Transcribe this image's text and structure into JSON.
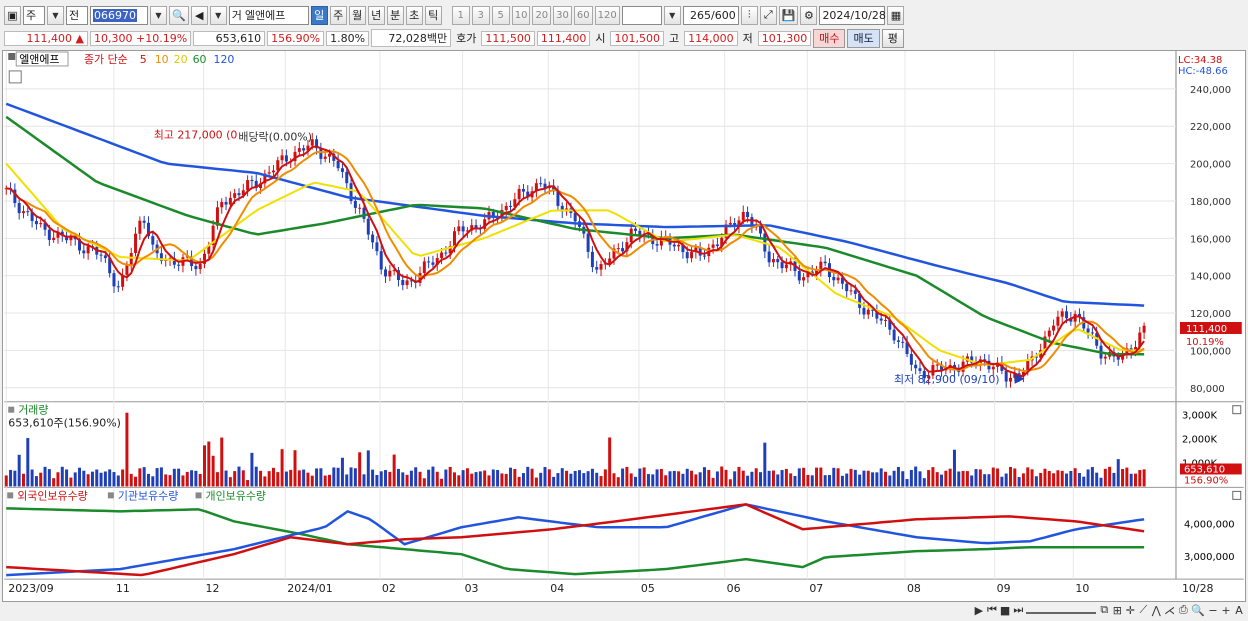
{
  "toolbar": {
    "period_type": "주",
    "prev_label": "전",
    "code": "066970",
    "stock_name_prefix": "거",
    "stock_name": "엘앤에프",
    "period_tabs": [
      "일",
      "주",
      "월",
      "년",
      "분",
      "초",
      "틱"
    ],
    "active_period": "일",
    "intervals": [
      "1",
      "3",
      "5",
      "10",
      "20",
      "30",
      "60",
      "120"
    ],
    "count": "265",
    "count_total": "/600",
    "date": "2024/10/28"
  },
  "quote": {
    "price": "111,400",
    "change": "10,300",
    "change_pct": "+10.19%",
    "volume": "653,610",
    "volume_ratio": "156.90%",
    "turnover_pct": "1.80%",
    "trade_value": "72,028백만",
    "ask_label": "호가",
    "ask1": "111,500",
    "ask2": "111,400",
    "open_label": "시",
    "open": "101,500",
    "high_label": "고",
    "high": "114,000",
    "low_label": "저",
    "low": "101,300",
    "buy_label": "매수",
    "sell_label": "매도",
    "eval_label": "평"
  },
  "price_panel": {
    "stock_tab": "엘앤에프",
    "legend_prefix": "종가 단순",
    "ma_periods": [
      "5",
      "10",
      "20",
      "60",
      "120"
    ],
    "ma_colors": [
      "#d01010",
      "#f08c00",
      "#f0e000",
      "#1a8a2a",
      "#2255dd"
    ],
    "lc": "LC:34.38",
    "hc": "HC:-48.66",
    "high_note": "최고 217,000 (0",
    "high_note2": "배당락(0.00%)",
    "low_note": "최저 82,900 (09/10)",
    "price_tag": "111,400",
    "pct_tag": "10.19%",
    "y_ticks": [
      "240,000",
      "220,000",
      "200,000",
      "180,000",
      "160,000",
      "140,000",
      "120,000",
      "100,000",
      "80,000"
    ]
  },
  "volume_panel": {
    "title": "거래량",
    "value": "653,610주(156.90%)",
    "y_ticks": [
      "3,000K",
      "2,000K",
      "1,000K"
    ],
    "tag1": "653,610",
    "tag2": "156.90%"
  },
  "holding_panel": {
    "legend": [
      "외국인보유수량",
      "기관보유수량",
      "개인보유수량"
    ],
    "colors": [
      "#d01010",
      "#2255dd",
      "#1a8a2a"
    ],
    "y_ticks": [
      "4,000,000",
      "3,000,000"
    ]
  },
  "x_axis": [
    "2023/09",
    "11",
    "12",
    "2024/01",
    "02",
    "03",
    "04",
    "05",
    "06",
    "07",
    "08",
    "09",
    "10",
    "10/28"
  ],
  "chart_data": {
    "type": "candlestick",
    "price_ylim": [
      80000,
      245000
    ],
    "high": 217000,
    "low": 82900,
    "last_close": 111400,
    "ma120_points": [
      [
        0,
        232000
      ],
      [
        0.14,
        200000
      ],
      [
        0.22,
        195000
      ],
      [
        0.3,
        182000
      ],
      [
        0.42,
        172000
      ],
      [
        0.5,
        168000
      ],
      [
        0.58,
        166000
      ],
      [
        0.67,
        167000
      ],
      [
        0.74,
        158000
      ],
      [
        0.82,
        145000
      ],
      [
        0.88,
        136000
      ],
      [
        0.93,
        126000
      ],
      [
        1.0,
        124000
      ]
    ],
    "ma60_points": [
      [
        0,
        225000
      ],
      [
        0.08,
        190000
      ],
      [
        0.16,
        172000
      ],
      [
        0.22,
        162000
      ],
      [
        0.28,
        168000
      ],
      [
        0.36,
        178000
      ],
      [
        0.42,
        176000
      ],
      [
        0.5,
        165000
      ],
      [
        0.58,
        160000
      ],
      [
        0.64,
        162000
      ],
      [
        0.72,
        155000
      ],
      [
        0.8,
        140000
      ],
      [
        0.86,
        118000
      ],
      [
        0.92,
        104000
      ],
      [
        0.97,
        98000
      ],
      [
        1.0,
        98000
      ]
    ],
    "ma20_points": [
      [
        0,
        200000
      ],
      [
        0.05,
        165000
      ],
      [
        0.1,
        150000
      ],
      [
        0.16,
        148000
      ],
      [
        0.22,
        175000
      ],
      [
        0.27,
        190000
      ],
      [
        0.31,
        185000
      ],
      [
        0.36,
        150000
      ],
      [
        0.42,
        160000
      ],
      [
        0.48,
        175000
      ],
      [
        0.53,
        175000
      ],
      [
        0.58,
        158000
      ],
      [
        0.64,
        162000
      ],
      [
        0.68,
        155000
      ],
      [
        0.73,
        130000
      ],
      [
        0.78,
        118000
      ],
      [
        0.82,
        100000
      ],
      [
        0.86,
        92000
      ],
      [
        0.9,
        95000
      ],
      [
        0.94,
        112000
      ],
      [
        0.98,
        100000
      ],
      [
        1.0,
        100000
      ]
    ]
  }
}
